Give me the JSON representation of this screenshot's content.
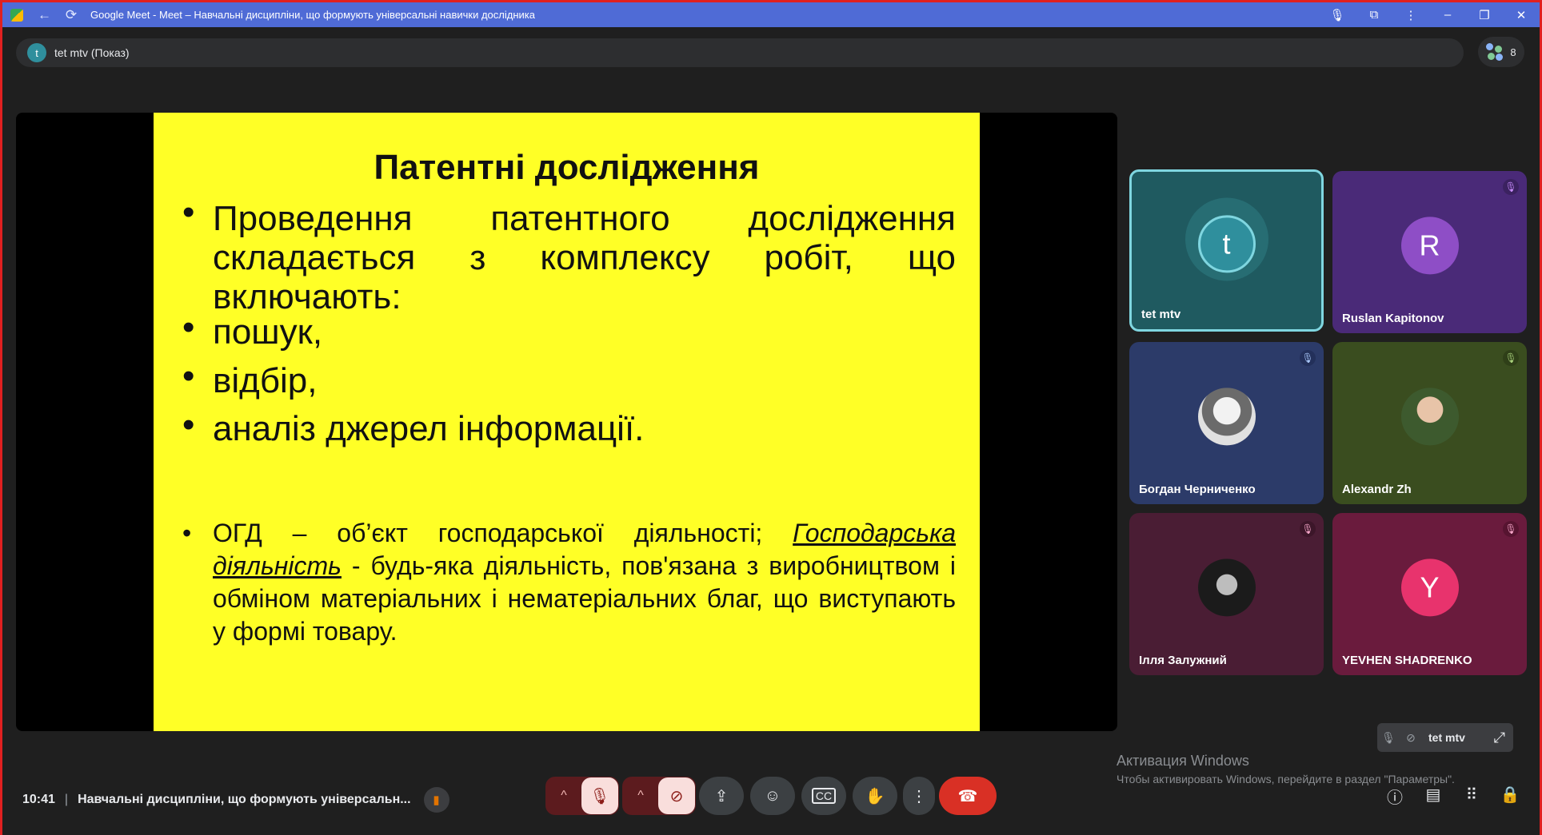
{
  "browser": {
    "tab_title": "Google Meet - Meet – Навчальні дисципліни, що формують універсальні навички дослідника",
    "window_controls": [
      "mic-icon",
      "extensions-icon",
      "kebab-menu-icon",
      "minimize-icon",
      "restore-icon",
      "close-icon"
    ]
  },
  "presenter": {
    "avatar_letter": "t",
    "label": "tet mtv (Показ)"
  },
  "people": {
    "count": "8"
  },
  "slide": {
    "title": "Патентні дослідження",
    "bullets": [
      "Проведення патентного дослідження складається з комплексу робіт, що включають:",
      "пошук,",
      "відбір,",
      "аналіз джерел інформації."
    ],
    "note": {
      "prefix": "ОГД – об’єкт господарської діяльності; ",
      "term": "Господарська діяльність",
      "suffix": " - будь-яка діяльність, пов'язана з виробництвом і обміном матеріальних і нематеріальних благ, що виступають у формі товару."
    }
  },
  "participants": [
    {
      "name": "tet mtv",
      "initial": "t",
      "color": "#2f8f9d",
      "bg": "#1f5a60",
      "muted": false,
      "active": true
    },
    {
      "name": "Ruslan Kapitonov",
      "initial": "R",
      "color": "#8e4ec6",
      "bg": "#4a2a78",
      "muted": true
    },
    {
      "name": "Богдан Черниченко",
      "initial": "",
      "color": "#cfcfcf",
      "bg": "#2c3b69",
      "muted": true
    },
    {
      "name": "Alexandr Zh",
      "initial": "",
      "color": "#5d7a3a",
      "bg": "#3a4d1f",
      "muted": true
    },
    {
      "name": "Ілля Залужний",
      "initial": "",
      "color": "#222",
      "bg": "#4a1d34",
      "muted": true
    },
    {
      "name": "YEVHEN SHADRENKO",
      "initial": "Y",
      "color": "#e8336d",
      "bg": "#6a1b3d",
      "muted": true
    }
  ],
  "selfview": {
    "label": "tet mtv"
  },
  "windows_activation": {
    "heading": "Активация Windows",
    "sub": "Чтобы активировать Windows, перейдите в раздел \"Параметры\"."
  },
  "bottom": {
    "time": "10:41",
    "meeting_title": "Навчальні дисципліни, що формують універсальн...",
    "controls": [
      "mic-off-icon",
      "camera-off-icon",
      "present-icon",
      "emoji-icon",
      "captions-icon",
      "raise-hand-icon",
      "more-icon",
      "end-call-icon"
    ],
    "right_icons": [
      "info-icon",
      "chat-icon",
      "activities-icon",
      "host-controls-icon"
    ]
  }
}
